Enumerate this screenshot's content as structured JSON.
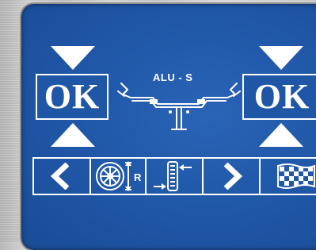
{
  "screen": {
    "program_label": "ALU - S",
    "ok_left_label": "OK",
    "ok_right_label": "OK"
  },
  "icons": {
    "prev": "chevron-left-icon",
    "wheel_radius": "wheel-radius-icon",
    "tyre_width": "tyre-width-icon",
    "next": "chevron-right-icon",
    "finish": "checkered-flag-icon"
  },
  "radius_mark": "R",
  "colors": {
    "screen_blue": "#1f56a6",
    "foreground": "#ffffff"
  }
}
